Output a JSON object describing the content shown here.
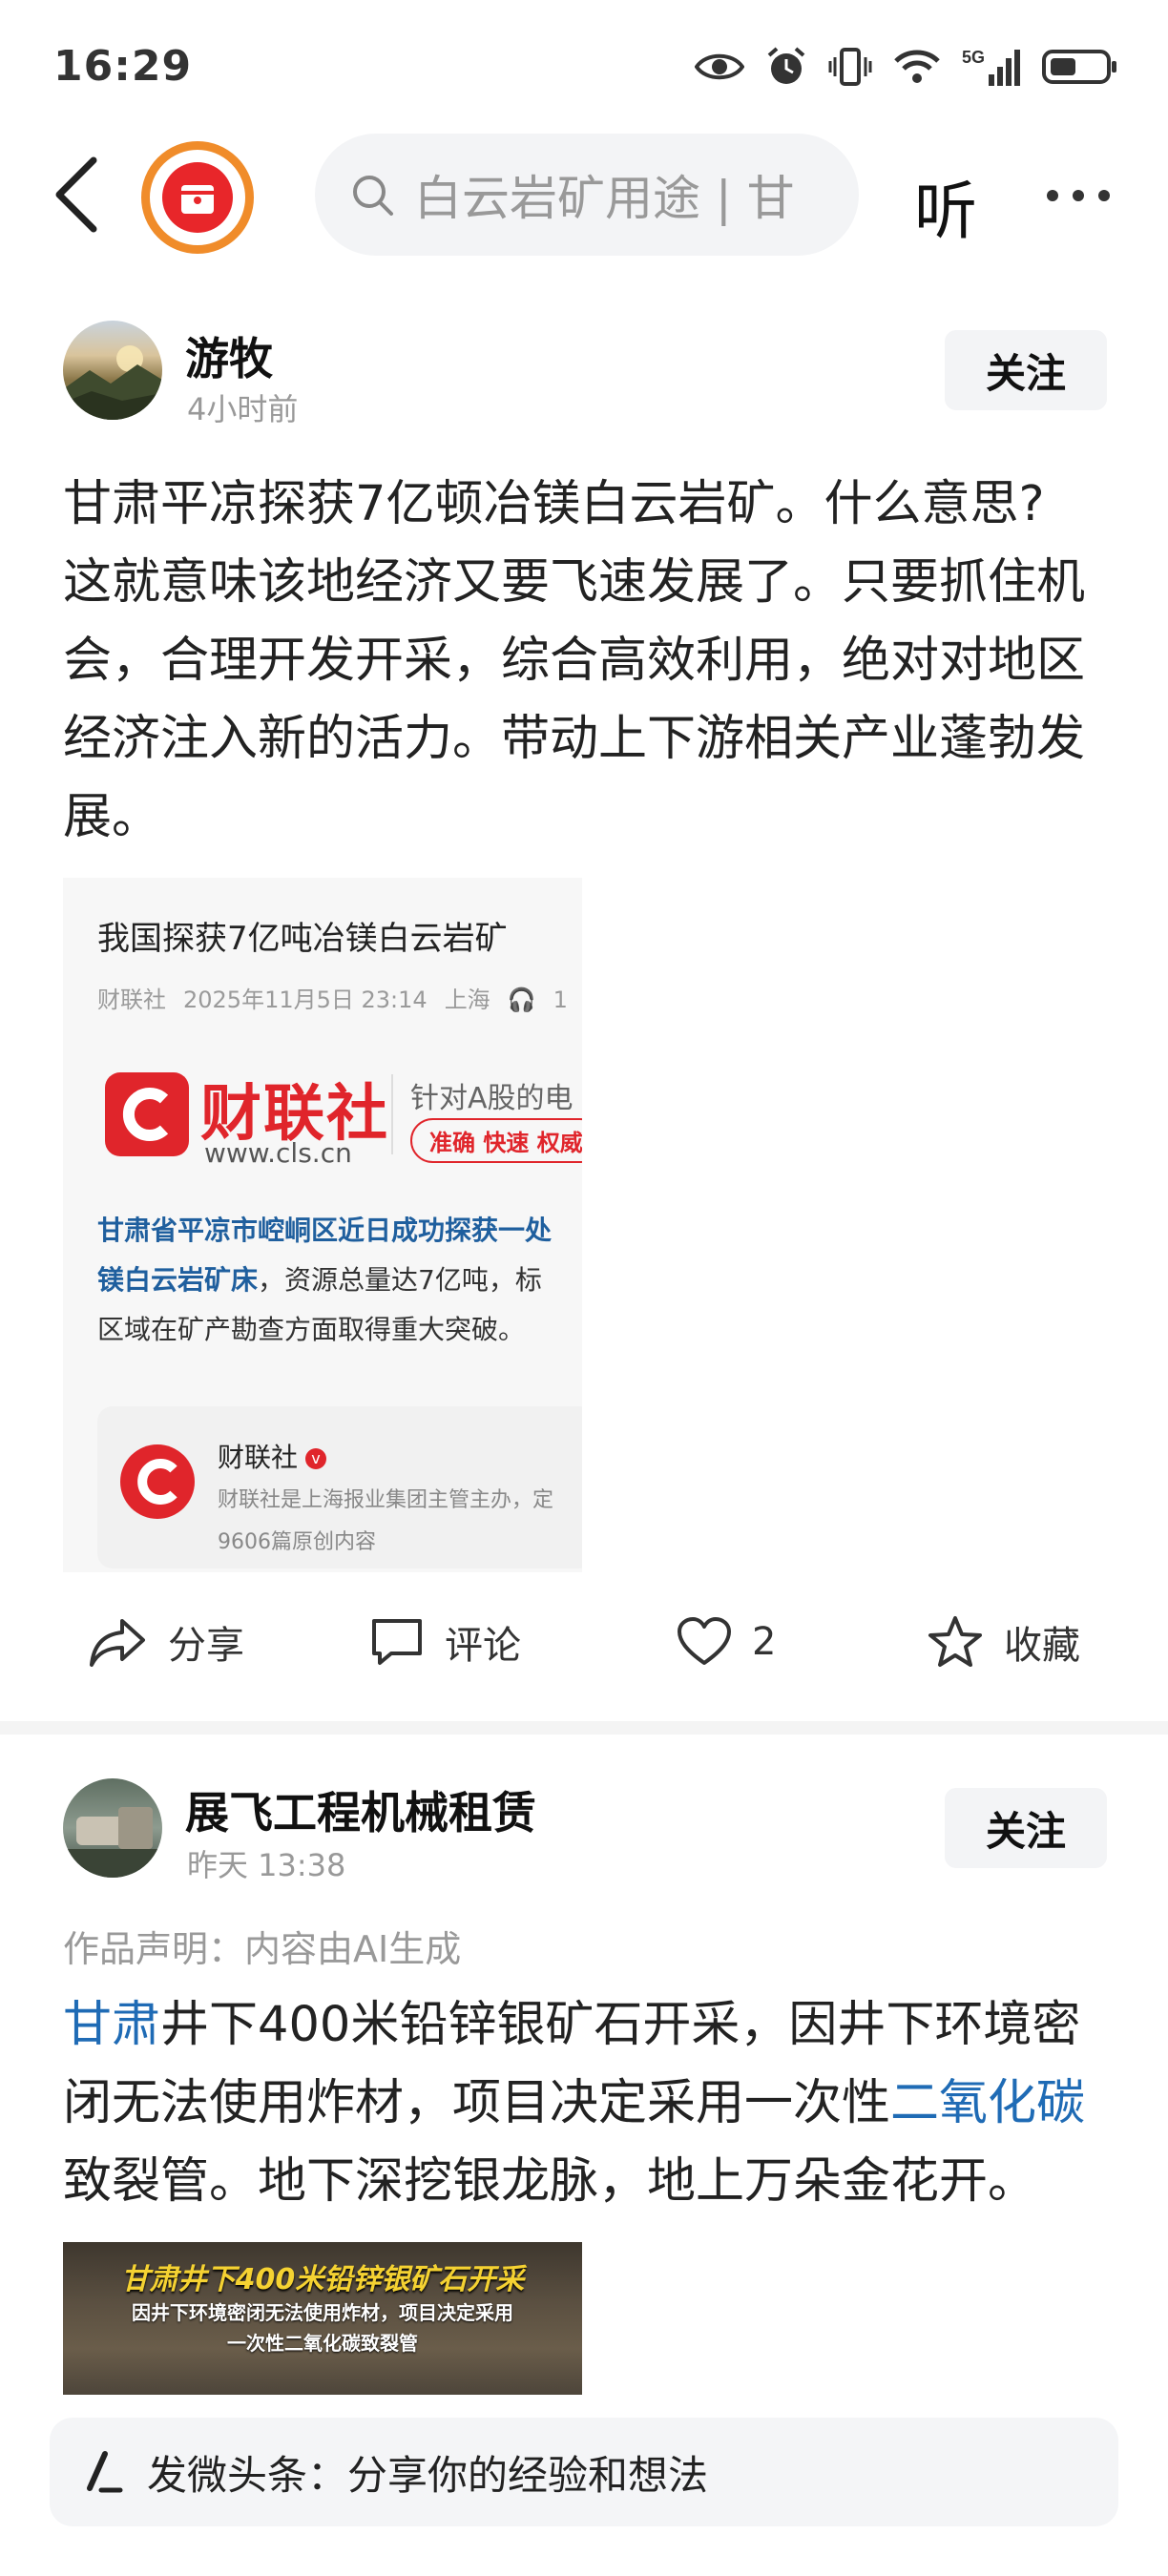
{
  "status_bar": {
    "time": "16:29",
    "network": "5G"
  },
  "nav": {
    "search_placeholder": "白云岩矿用途 | 甘",
    "listen_label": "听"
  },
  "post1": {
    "author": "游牧",
    "time": "4小时前",
    "follow_label": "关注",
    "text_lines": [
      "甘肃平凉探获7亿顿冶镁白云岩矿。什么意思?",
      "这就意味该地经济又要飞速发展了。只要抓住机",
      "会，合理开发开采，综合高效利用，绝对对地区",
      "经济注入新的活力。带动上下游相关产业蓬勃发",
      "展。"
    ],
    "card": {
      "title": "我国探获7亿吨冶镁白云岩矿",
      "source": "财联社",
      "datetime": "2025年11月5日 23:14",
      "location": "上海",
      "listen_count": "1",
      "brand_name": "财联社",
      "brand_url": "www.cls.cn",
      "slogan": "针对A股的电",
      "tag": "准确 快速 权威",
      "highlight": "甘肃省平凉市崆峒区近日成功探获一处",
      "highlight_link": "镁白云岩矿床",
      "body_after_link": "，资源总量达7亿吨，标",
      "body_line2": "区域在矿产勘查方面取得重大突破。",
      "source_box": {
        "name": "财联社",
        "desc": "财联社是上海报业集团主管主办，定",
        "count": "9606篇原创内容"
      }
    },
    "actions": {
      "share": "分享",
      "comment": "评论",
      "likes": "2",
      "favorite": "收藏"
    }
  },
  "post2": {
    "author": "展飞工程机械租赁",
    "time": "昨天 13:38",
    "follow_label": "关注",
    "ai_note": "作品声明：内容由AI生成",
    "line1_link": "甘肃",
    "line1_rest": "井下400米铅锌银矿石开采，因井下环境密",
    "line2_start": "闭无法使用炸材，项目决定采用一次性",
    "line2_link": "二氧化碳",
    "line3": "致裂管。地下深挖银龙脉，地上万朵金花开。",
    "thumb": {
      "line1": "甘肃井下400米铅锌银矿石开采",
      "line2": "因井下环境密闭无法使用炸材，项目决定采用",
      "line3": "一次性二氧化碳致裂管"
    }
  },
  "comment_bar": {
    "placeholder": "发微头条：分享你的经验和想法"
  },
  "colors": {
    "accent_red": "#e0252b",
    "link_blue": "#1f6bb5",
    "logo_orange": "#f08c2a"
  }
}
